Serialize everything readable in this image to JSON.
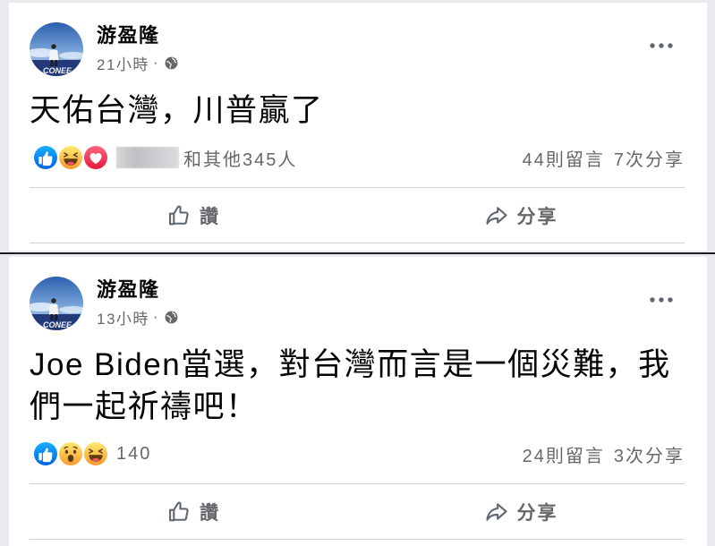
{
  "posts": [
    {
      "author": "游盈隆",
      "avatar_caption": "CONEE",
      "time": "21小時",
      "separator": "·",
      "privacy_icon": "globe-icon",
      "text_lines": [
        "天佑台灣，川普贏了"
      ],
      "reactions": [
        "like-icon",
        "haha-icon",
        "love-icon"
      ],
      "reaction_summary": "和其他345人",
      "comments": "44則留言",
      "shares": "7次分享",
      "actions": {
        "like": "讚",
        "share": "分享"
      }
    },
    {
      "author": "游盈隆",
      "avatar_caption": "CONEE",
      "time": "13小時",
      "separator": "·",
      "privacy_icon": "globe-icon",
      "text_lines": [
        "Joe Biden當選，對台灣而言是一個災難，我",
        "們一起祈禱吧！"
      ],
      "reactions": [
        "like-icon",
        "wow-icon",
        "haha-icon"
      ],
      "reaction_summary": "140",
      "comments": "24則留言",
      "shares": "3次分享",
      "actions": {
        "like": "讚",
        "share": "分享"
      }
    }
  ],
  "colors": {
    "like_blue": "#1877f2",
    "haha_wow_yellow": "#f7c83e",
    "love_red": "#f33e58",
    "secondary_text": "#65676b",
    "divider": "#ced0d4"
  }
}
